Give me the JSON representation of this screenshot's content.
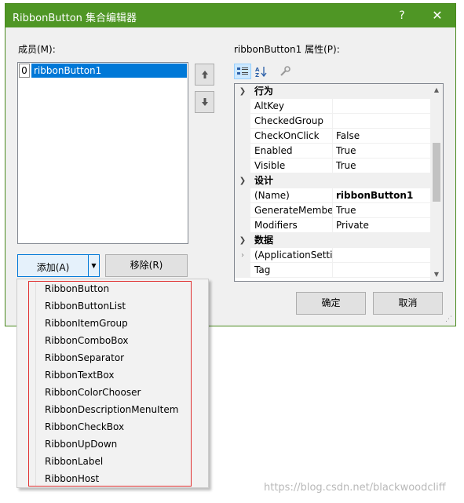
{
  "window": {
    "title": "RibbonButton 集合编辑器",
    "help_glyph": "?",
    "close_glyph": "✕"
  },
  "members": {
    "label": "成员(M):",
    "items": [
      {
        "index": "0",
        "name": "ribbonButton1"
      }
    ],
    "add_label": "添加(A)",
    "remove_label": "移除(R)"
  },
  "properties": {
    "label": "ribbonButton1 属性(P):",
    "categories": [
      {
        "name": "行为",
        "rows": [
          {
            "name": "AltKey",
            "value": ""
          },
          {
            "name": "CheckedGroup",
            "value": ""
          },
          {
            "name": "CheckOnClick",
            "value": "False"
          },
          {
            "name": "Enabled",
            "value": "True"
          },
          {
            "name": "Visible",
            "value": "True"
          }
        ]
      },
      {
        "name": "设计",
        "rows": [
          {
            "name": "(Name)",
            "value": "ribbonButton1"
          },
          {
            "name": "GenerateMembe",
            "value": "True"
          },
          {
            "name": "Modifiers",
            "value": "Private"
          }
        ]
      },
      {
        "name": "数据",
        "rows": [
          {
            "name": "(ApplicationSettir",
            "value": ""
          },
          {
            "name": "Tag",
            "value": ""
          }
        ]
      }
    ]
  },
  "buttons": {
    "ok": "确定",
    "cancel": "取消"
  },
  "dropdown_items": [
    "RibbonButton",
    "RibbonButtonList",
    "RibbonItemGroup",
    "RibbonComboBox",
    "RibbonSeparator",
    "RibbonTextBox",
    "RibbonColorChooser",
    "RibbonDescriptionMenuItem",
    "RibbonCheckBox",
    "RibbonUpDown",
    "RibbonLabel",
    "RibbonHost"
  ],
  "watermark": "https://blog.csdn.net/blackwoodcliff",
  "colors": {
    "title_bar": "#4f9625",
    "selection": "#0078d7",
    "highlight_border": "#e03030"
  }
}
